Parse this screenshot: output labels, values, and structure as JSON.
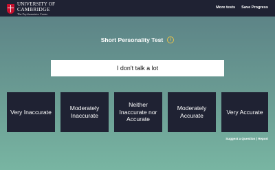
{
  "header": {
    "logo_line1": "UNIVERSITY OF",
    "logo_line2": "CAMBRIDGE",
    "logo_line3": "The Psychometrics Centre",
    "nav": [
      "More tests",
      "Save Progress"
    ]
  },
  "test": {
    "title": "Short Personality Test",
    "info_symbol": "i",
    "question": "I don't talk a lot"
  },
  "answers": [
    "Very Inaccurate",
    "Moderately Inaccurate",
    "Neither Inaccurate nor Accurate",
    "Moderately Accurate",
    "Very Accurate"
  ],
  "footer": {
    "suggest": "Suggest a Question",
    "separator": " | ",
    "report": "Report"
  }
}
